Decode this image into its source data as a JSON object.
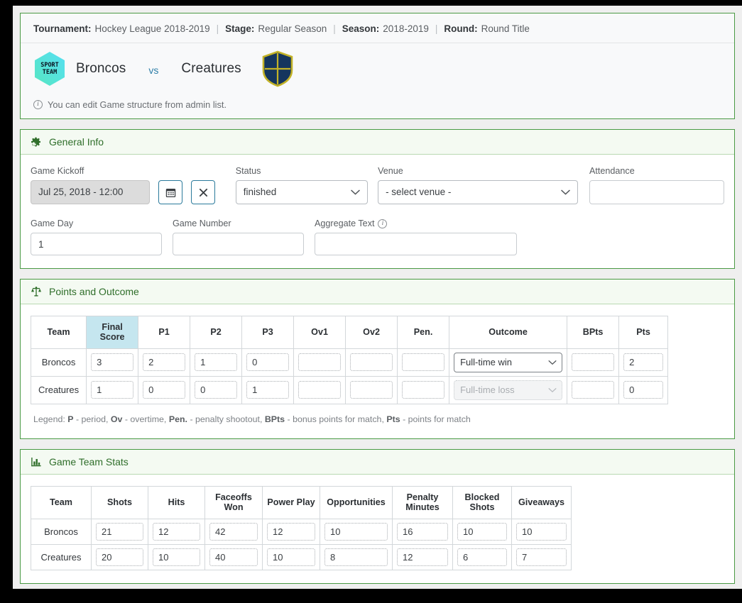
{
  "header": {
    "meta": [
      {
        "label": "Tournament:",
        "value": "Hockey League 2018-2019"
      },
      {
        "label": "Stage:",
        "value": "Regular Season"
      },
      {
        "label": "Season:",
        "value": "2018-2019"
      },
      {
        "label": "Round:",
        "value": "Round Title"
      }
    ],
    "separator": "|",
    "home_team": "Broncos",
    "away_team": "Creatures",
    "vs": "vs",
    "home_logo_text_line1": "SPORT",
    "home_logo_text_line2": "TEAM",
    "note": "You can edit Game structure from admin list."
  },
  "general_info": {
    "title": "General Info",
    "icon": "gear-icon",
    "kickoff_label": "Game Kickoff",
    "kickoff_value": "Jul 25, 2018 - 12:00",
    "calendar_icon": "calendar-icon",
    "clear_icon": "close-icon",
    "status_label": "Status",
    "status_value": "finished",
    "venue_label": "Venue",
    "venue_value": "- select venue -",
    "attendance_label": "Attendance",
    "attendance_value": "",
    "game_day_label": "Game Day",
    "game_day_value": "1",
    "game_number_label": "Game Number",
    "game_number_value": "",
    "aggregate_label": "Aggregate Text",
    "aggregate_value": ""
  },
  "points_outcome": {
    "title": "Points and Outcome",
    "icon": "scales-icon",
    "columns": [
      "Team",
      "Final Score",
      "P1",
      "P2",
      "P3",
      "Ov1",
      "Ov2",
      "Pen.",
      "Outcome",
      "BPts",
      "Pts"
    ],
    "highlight_column": "Final Score",
    "rows": [
      {
        "team": "Broncos",
        "final_score": "3",
        "p1": "2",
        "p2": "1",
        "p3": "0",
        "ov1": "",
        "ov2": "",
        "pen": "",
        "outcome": "Full-time win",
        "outcome_disabled": false,
        "bpts": "",
        "pts": "2"
      },
      {
        "team": "Creatures",
        "final_score": "1",
        "p1": "0",
        "p2": "0",
        "p3": "1",
        "ov1": "",
        "ov2": "",
        "pen": "",
        "outcome": "Full-time loss",
        "outcome_disabled": true,
        "bpts": "",
        "pts": "0"
      }
    ],
    "legend_prefix": "Legend:",
    "legend_parts": [
      {
        "abbr": "P",
        "desc": " - period,"
      },
      {
        "abbr": "Ov",
        "desc": " - overtime,"
      },
      {
        "abbr": "Pen.",
        "desc": " - penalty shootout,"
      },
      {
        "abbr": "BPts",
        "desc": " - bonus points for match,"
      },
      {
        "abbr": "Pts",
        "desc": " - points for match"
      }
    ]
  },
  "team_stats": {
    "title": "Game Team Stats",
    "icon": "bar-chart-icon",
    "columns": [
      "Team",
      "Shots",
      "Hits",
      "Faceoffs Won",
      "Power Play",
      "Opportunities",
      "Penalty Minutes",
      "Blocked Shots",
      "Giveaways"
    ],
    "rows": [
      {
        "team": "Broncos",
        "shots": "21",
        "hits": "12",
        "faceoffs_won": "42",
        "power_play": "12",
        "opportunities": "10",
        "penalty_minutes": "16",
        "blocked_shots": "10",
        "giveaways": "10"
      },
      {
        "team": "Creatures",
        "shots": "20",
        "hits": "10",
        "faceoffs_won": "40",
        "power_play": "10",
        "opportunities": "8",
        "penalty_minutes": "12",
        "blocked_shots": "6",
        "giveaways": "7"
      }
    ]
  },
  "colors": {
    "panel_border": "#4a9a44",
    "section_header_bg": "#f4faf2",
    "section_title": "#2f6e2a",
    "highlight_cell": "#c5e6ef",
    "accent_blue": "#2a7a9b",
    "home_logo_from": "#5fe0c0",
    "home_logo_to": "#58e0f0",
    "away_logo_fill": "#14355e",
    "away_logo_stroke": "#c2b227"
  }
}
